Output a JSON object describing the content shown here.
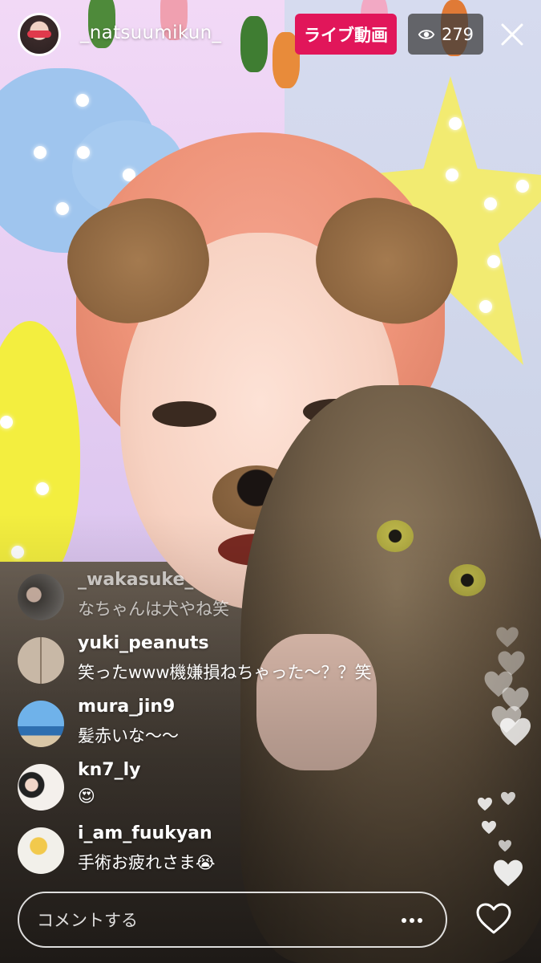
{
  "header": {
    "host_username": "_natsuumikun_",
    "live_label": "ライブ動画",
    "viewer_count": "279",
    "live_color": "#e1165a"
  },
  "comments": [
    {
      "username": "_wakasuke_",
      "text": "なちゃんは犬やね笑"
    },
    {
      "username": "yuki_peanuts",
      "text": "笑ったwww機嫌損ねちゃった〜？？笑"
    },
    {
      "username": "mura_jin9",
      "text": "髪赤いな〜〜"
    },
    {
      "username": "kn7_ly",
      "text": "😍"
    },
    {
      "username": "i_am_fuukyan",
      "text": "手術お疲れさま😭"
    }
  ],
  "composer": {
    "placeholder": "コメントする"
  },
  "icons": [
    "close-icon",
    "eye-icon",
    "more-icon",
    "heart-icon"
  ]
}
